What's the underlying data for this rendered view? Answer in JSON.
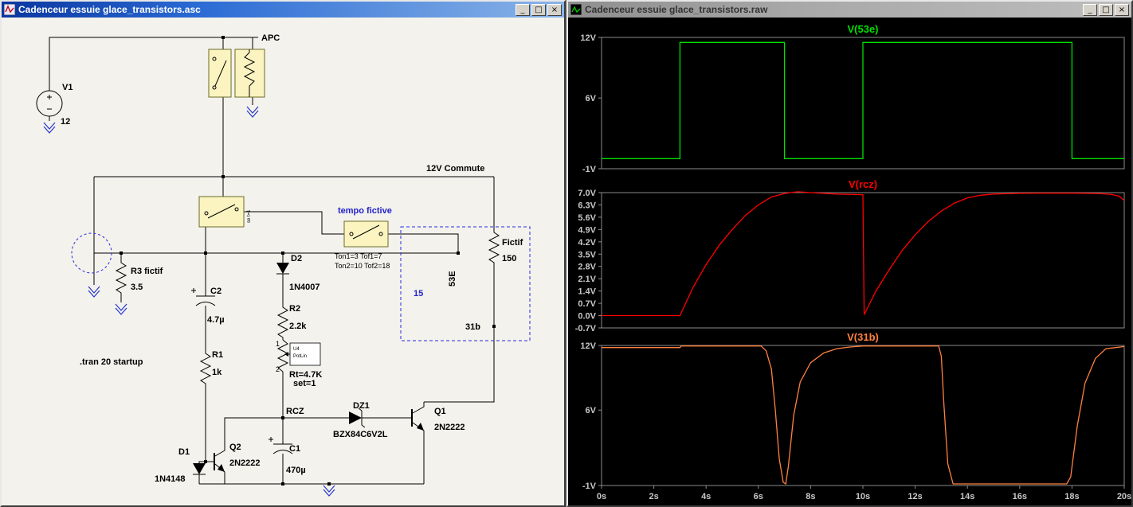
{
  "left_window": {
    "title": "Cadenceur essuie glace_transistors.asc",
    "buttons": {
      "minimize": "_",
      "maximize": "□",
      "close": "×"
    },
    "schematic": {
      "apc": "APC",
      "v1_name": "V1",
      "v1_value": "12",
      "bus_label": "12V  Commute",
      "tempo_title": "tempo fictive",
      "tempo_line1": "Ton1=3 Tof1=7",
      "tempo_line2": "Ton2=10 Tof2=18",
      "r3_name": "R3  fictif",
      "r3_value": "3.5",
      "c2_name": "C2",
      "c2_value": "4.7µ",
      "d2_name": "D2",
      "d2_value": "1N4007",
      "r2_name": "R2",
      "r2_value": "2.2k",
      "r1_name": "R1",
      "r1_value": "1k",
      "pot_pin1": "1",
      "pot_pin2": "2",
      "pot_ref": "U4",
      "pot_model": "PotLin",
      "pot_value": "Rt=4.7K",
      "pot_set": "set=1",
      "tran_directive": ".tran 20 startup",
      "d1_name": "D1",
      "d1_value": "1N4148",
      "q2_name": "Q2",
      "q2_value": "2N2222",
      "c1_name": "C1",
      "c1_value": "470µ",
      "rcz": "RCZ",
      "dz1_name": "DZ1",
      "dz1_value": "BZX84C6V2L",
      "q1_name": "Q1",
      "q1_value": "2N2222",
      "rfictif_name": "Fictif",
      "rfictif_value": "150",
      "node_53e": "53E",
      "node_31b": "31b",
      "node_15": "15",
      "relay2_note": "se t=1"
    }
  },
  "right_window": {
    "title": "Cadenceur essuie glace_transistors.raw",
    "buttons": {
      "minimize": "_",
      "maximize": "□",
      "close": "×"
    },
    "x_axis": {
      "labels": [
        "0s",
        "2s",
        "4s",
        "6s",
        "8s",
        "10s",
        "12s",
        "14s",
        "16s",
        "18s",
        "20s"
      ],
      "values": [
        0,
        2,
        4,
        6,
        8,
        10,
        12,
        14,
        16,
        18,
        20
      ]
    }
  },
  "colors": {
    "trace_green": "#00e000",
    "trace_red": "#ff0000",
    "trace_orange": "#ff8040",
    "plot_bg": "#000000",
    "axis": "#c8c8c8"
  },
  "chart_data": [
    {
      "type": "line",
      "title": "V(53e)",
      "color": "#00e000",
      "xlim": [
        0,
        20
      ],
      "ylim": [
        -1,
        12
      ],
      "yticks": [
        {
          "v": 12,
          "label": "12V"
        },
        {
          "v": 6,
          "label": "6V"
        },
        {
          "v": -1,
          "label": "-1V"
        }
      ],
      "x": [
        0,
        3,
        3,
        7,
        7,
        10,
        10,
        18,
        18,
        20
      ],
      "y": [
        0,
        0,
        11.5,
        11.5,
        0,
        0,
        11.5,
        11.5,
        0,
        0
      ]
    },
    {
      "type": "line",
      "title": "V(rcz)",
      "color": "#ff0000",
      "xlim": [
        0,
        20
      ],
      "ylim": [
        -0.7,
        7.0
      ],
      "yticks": [
        {
          "v": 7.0,
          "label": "7.0V"
        },
        {
          "v": 6.3,
          "label": "6.3V"
        },
        {
          "v": 5.6,
          "label": "5.6V"
        },
        {
          "v": 4.9,
          "label": "4.9V"
        },
        {
          "v": 4.2,
          "label": "4.2V"
        },
        {
          "v": 3.5,
          "label": "3.5V"
        },
        {
          "v": 2.8,
          "label": "2.8V"
        },
        {
          "v": 2.1,
          "label": "2.1V"
        },
        {
          "v": 1.4,
          "label": "1.4V"
        },
        {
          "v": 0.7,
          "label": "0.7V"
        },
        {
          "v": 0.0,
          "label": "0.0V"
        },
        {
          "v": -0.7,
          "label": "-0.7V"
        }
      ],
      "x": [
        0,
        3,
        3.5,
        4,
        4.5,
        5,
        5.5,
        6,
        6.5,
        7,
        7.5,
        8,
        9,
        10,
        10.05,
        10.5,
        11,
        11.5,
        12,
        12.5,
        13,
        13.5,
        14,
        14.5,
        15,
        16,
        17,
        18,
        19,
        19.5,
        19.8,
        20
      ],
      "y": [
        0,
        0,
        1.6,
        2.9,
        4.0,
        4.9,
        5.7,
        6.3,
        6.75,
        6.95,
        7.05,
        7.0,
        6.92,
        6.88,
        0.05,
        1.4,
        2.6,
        3.7,
        4.6,
        5.35,
        5.95,
        6.4,
        6.7,
        6.85,
        6.92,
        6.96,
        6.97,
        6.97,
        6.95,
        6.9,
        6.8,
        6.55
      ]
    },
    {
      "type": "line",
      "title": "V(31b)",
      "color": "#ff8040",
      "xlim": [
        0,
        20
      ],
      "ylim": [
        -1,
        12
      ],
      "yticks": [
        {
          "v": 12,
          "label": "12V"
        },
        {
          "v": 6,
          "label": "6V"
        },
        {
          "v": -1,
          "label": "-1V"
        }
      ],
      "x": [
        0,
        3,
        3.05,
        6.1,
        6.3,
        6.5,
        6.65,
        6.8,
        6.95,
        7.05,
        7.15,
        7.35,
        7.6,
        8,
        8.5,
        9,
        9.5,
        10,
        12.9,
        13.0,
        13.1,
        13.25,
        13.45,
        17.8,
        17.95,
        18.2,
        18.5,
        18.9,
        19.3,
        20
      ],
      "y": [
        11.8,
        11.8,
        11.95,
        11.95,
        11.5,
        9.8,
        6.0,
        1.5,
        -0.7,
        -0.85,
        0.8,
        5.5,
        8.6,
        10.4,
        11.3,
        11.7,
        11.85,
        11.95,
        11.95,
        11.0,
        6.5,
        1.0,
        -0.85,
        -0.85,
        -0.2,
        4.5,
        8.5,
        10.8,
        11.7,
        11.9
      ]
    }
  ]
}
